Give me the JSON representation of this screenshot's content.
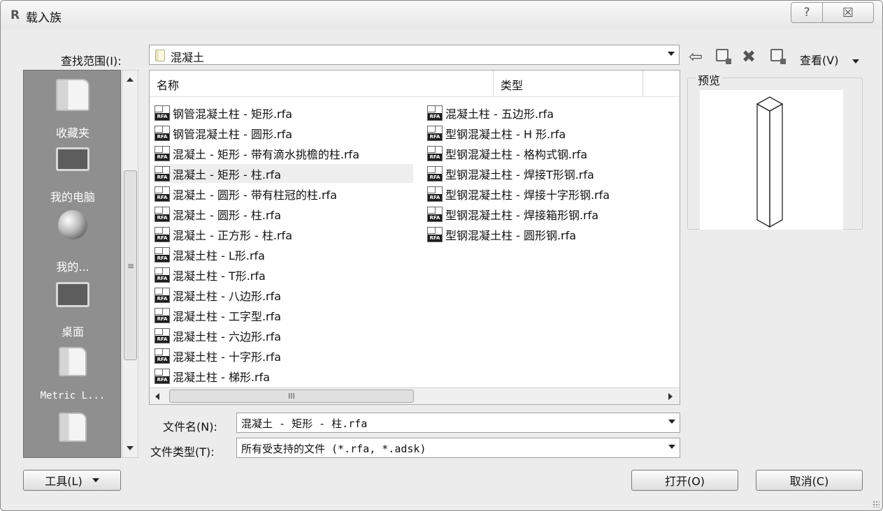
{
  "window": {
    "title": "载入族",
    "logo": "R",
    "help_glyph": "?",
    "close_glyph": "☒"
  },
  "lookin": {
    "label": "查找范围(I):",
    "value": "混凝土"
  },
  "toolbar": {
    "view_label": "查看(V)"
  },
  "places": [
    {
      "label": "收藏夹",
      "icon": "favorites-folder-icon"
    },
    {
      "label": "我的电脑",
      "icon": "computer-icon"
    },
    {
      "label": "我的...",
      "icon": "network-globe-icon"
    },
    {
      "label": "桌面",
      "icon": "desktop-icon"
    },
    {
      "label": "Metric L...",
      "icon": "folder-icon"
    },
    {
      "label": "",
      "icon": "folder-icon"
    }
  ],
  "columns": {
    "name": "名称",
    "type": "类型"
  },
  "files_col1": [
    "钢管混凝土柱 - 矩形.rfa",
    "钢管混凝土柱 - 圆形.rfa",
    "混凝土 - 矩形 - 带有滴水挑檐的柱.rfa",
    "混凝土 - 矩形 - 柱.rfa",
    "混凝土 - 圆形 - 带有柱冠的柱.rfa",
    "混凝土 - 圆形 - 柱.rfa",
    "混凝土 - 正方形 - 柱.rfa",
    "混凝土柱 - L形.rfa",
    "混凝土柱 - T形.rfa",
    "混凝土柱 - 八边形.rfa",
    "混凝土柱 - 工字型.rfa",
    "混凝土柱 - 六边形.rfa",
    "混凝土柱 - 十字形.rfa",
    "混凝土柱 - 梯形.rfa"
  ],
  "files_col2": [
    "混凝土柱 - 五边形.rfa",
    "型钢混凝土柱 - H 形.rfa",
    "型钢混凝土柱 - 格构式钢.rfa",
    "型钢混凝土柱 - 焊接T形钢.rfa",
    "型钢混凝土柱 - 焊接十字形钢.rfa",
    "型钢混凝土柱 - 焊接箱形钢.rfa",
    "型钢混凝土柱 - 圆形钢.rfa"
  ],
  "selected_file": "混凝土 - 矩形 - 柱.rfa",
  "file_icon_text": "RFA",
  "hscroll_grip": "III",
  "preview": {
    "label": "预览"
  },
  "filename": {
    "label": "文件名(N):",
    "value": "混凝土 - 矩形 - 柱.rfa"
  },
  "filetype": {
    "label": "文件类型(T):",
    "value": "所有受支持的文件 (*.rfa, *.adsk)"
  },
  "buttons": {
    "tools": "工具(L)",
    "open": "打开(O)",
    "cancel": "取消(C)"
  }
}
